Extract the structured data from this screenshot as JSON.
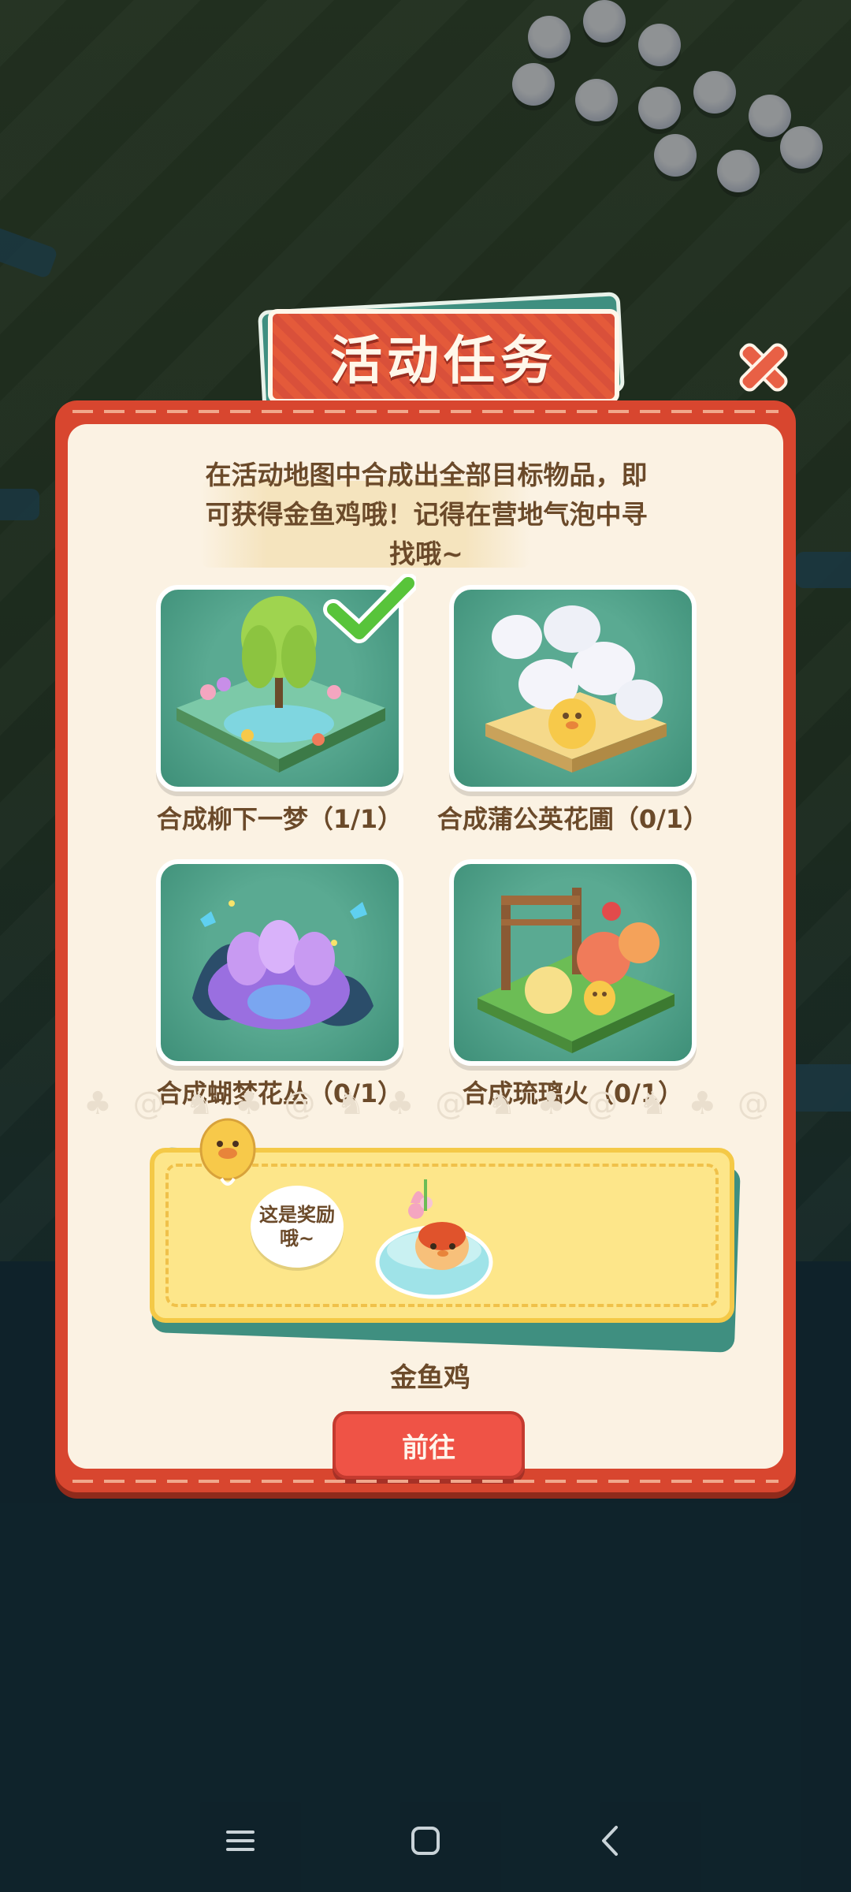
{
  "title": "活动任务",
  "description": "在活动地图中合成出全部目标物品，即可获得金鱼鸡哦！记得在营地气泡中寻找哦~",
  "tasks": [
    {
      "label": "合成柳下一梦（1/1）",
      "completed": true,
      "icon": "willow-garden-icon"
    },
    {
      "label": "合成蒲公英花圃（0/1）",
      "completed": false,
      "icon": "dandelion-garden-icon"
    },
    {
      "label": "合成蝴梦花丛（0/1）",
      "completed": false,
      "icon": "butterfly-flower-icon"
    },
    {
      "label": "合成琉璃火（0/1）",
      "completed": false,
      "icon": "peony-arch-icon"
    }
  ],
  "reward": {
    "bubble_text": "这是奖励哦~",
    "name": "金鱼鸡",
    "icon": "goldfish-chicken-icon"
  },
  "go_button": "前往",
  "colors": {
    "panel_red": "#d8462f",
    "panel_cream": "#fbf2e3",
    "card_teal": "#3e8f78",
    "reward_yellow": "#fde68a",
    "button_red": "#ef5346",
    "text_brown": "#6b4a2a"
  },
  "nav": {
    "menu_icon": "menu-icon",
    "home_icon": "home-square-icon",
    "back_icon": "back-chevron-icon"
  }
}
